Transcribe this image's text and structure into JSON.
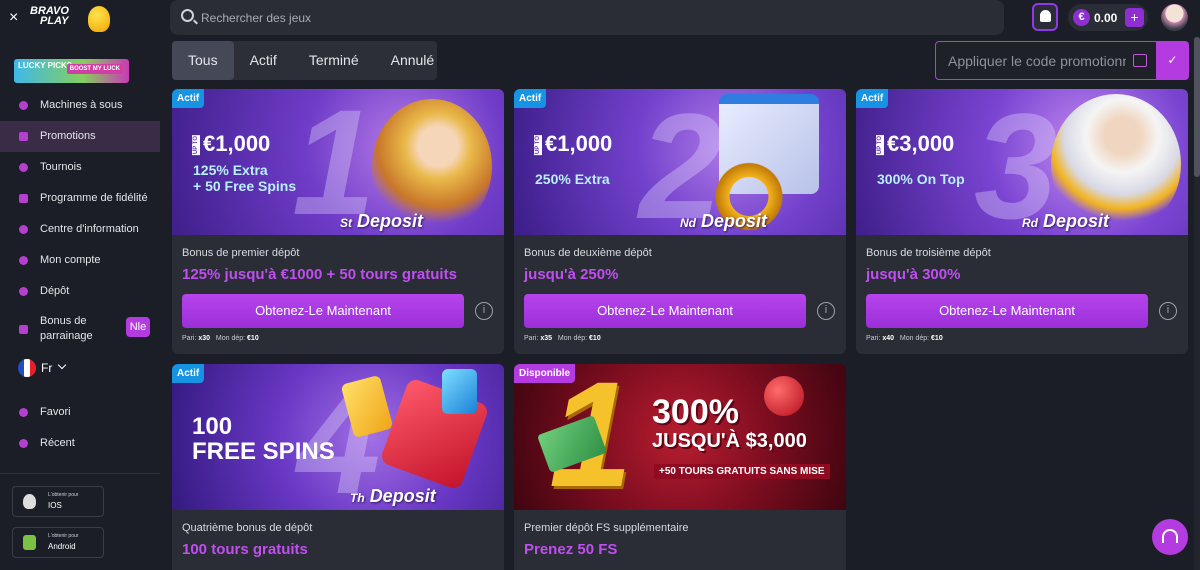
{
  "topbar": {
    "close_label": "×",
    "logo_line1": "BRAVO",
    "logo_line2": "PLAY",
    "search_placeholder": "Rechercher des jeux",
    "balance": "0.00",
    "currency_symbol": "€",
    "plus_label": "+"
  },
  "sidebar": {
    "banner_title": "LUCKY PICKS",
    "banner_cta": "BOOST MY LUCK",
    "items": [
      {
        "label": "Machines à sous"
      },
      {
        "label": "Promotions"
      },
      {
        "label": "Tournois"
      },
      {
        "label": "Programme de fidélité"
      },
      {
        "label": "Centre d'information"
      },
      {
        "label": "Mon compte"
      },
      {
        "label": "Dépôt"
      },
      {
        "label": "Bonus de parrainage"
      }
    ],
    "new_badge": "Nle",
    "language": "Fr",
    "favorites": "Favori",
    "recent": "Récent",
    "apps": [
      {
        "small": "L'obtenir pour",
        "big": "IOS"
      },
      {
        "small": "L'obtenir pour",
        "big": "Android"
      }
    ]
  },
  "filters": {
    "tabs": [
      "Tous",
      "Actif",
      "Terminé",
      "Annulé"
    ],
    "active_tab": "Tous",
    "promo_placeholder": "Appliquer le code promotionnel",
    "promo_apply": "✓"
  },
  "cards": [
    {
      "status": "Actif",
      "amount": "€1,000",
      "upto": "UP TO",
      "extra": [
        "125% Extra",
        "+ 50 Free Spins"
      ],
      "number": "1",
      "ordinal": "St",
      "deposit": "Deposit",
      "title": "Bonus de premier dépôt",
      "subtitle": "125% jusqu'à €1000 + 50 tours gratuits",
      "button": "Obtenez-Le Maintenant",
      "wager_label": "Pari:",
      "wager": "x30",
      "min_label": "Mon dép:",
      "min": "€10"
    },
    {
      "status": "Actif",
      "amount": "€1,000",
      "upto": "UP TO",
      "extra": [
        "250% Extra"
      ],
      "number": "2",
      "ordinal": "Nd",
      "deposit": "Deposit",
      "title": "Bonus de deuxième dépôt",
      "subtitle": "jusqu'à 250%",
      "button": "Obtenez-Le Maintenant",
      "wager_label": "Pari:",
      "wager": "x35",
      "min_label": "Mon dép:",
      "min": "€10"
    },
    {
      "status": "Actif",
      "amount": "€3,000",
      "upto": "UP TO",
      "extra": [
        "300% On Top"
      ],
      "number": "3",
      "ordinal": "Rd",
      "deposit": "Deposit",
      "title": "Bonus de troisième dépôt",
      "subtitle": "jusqu'à 300%",
      "button": "Obtenez-Le Maintenant",
      "wager_label": "Pari:",
      "wager": "x40",
      "min_label": "Mon dép:",
      "min": "€10"
    },
    {
      "status": "Actif",
      "fs_line1": "100",
      "fs_line2": "FREE SPINS",
      "number": "4",
      "ordinal": "Th",
      "deposit": "Deposit",
      "title": "Quatrième bonus de dépôt",
      "subtitle": "100 tours gratuits"
    },
    {
      "status": "Disponible",
      "number": "1",
      "pct": "300%",
      "upto": "JUSQU'À $3,000",
      "tours": "+50 TOURS GRATUITS SANS MISE",
      "title": "Premier dépôt FS supplémentaire",
      "subtitle": "Prenez 50 FS"
    }
  ]
}
